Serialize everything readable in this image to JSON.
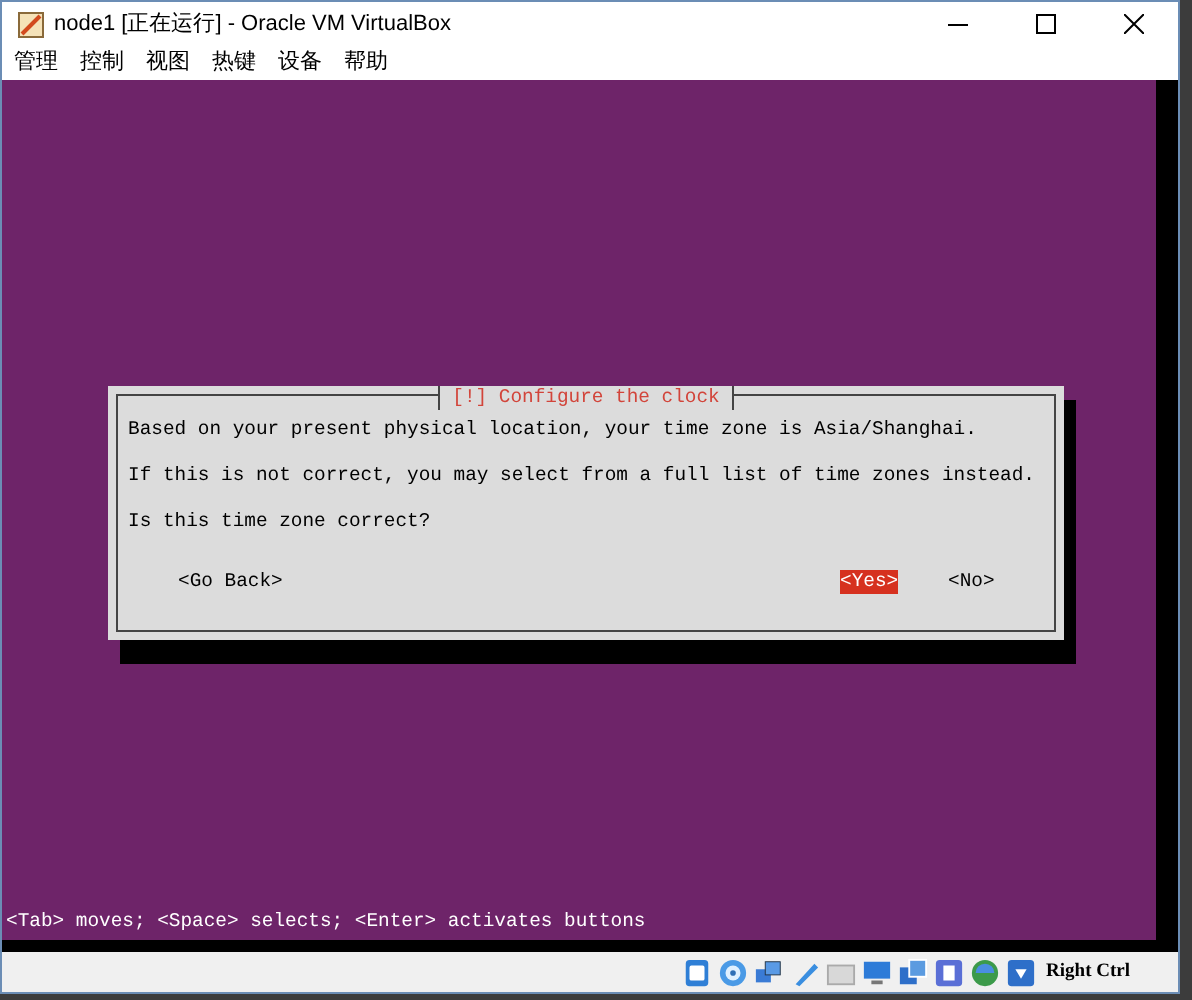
{
  "window": {
    "title": "node1 [正在运行] - Oracle VM VirtualBox"
  },
  "menu": [
    "管理",
    "控制",
    "视图",
    "热键",
    "设备",
    "帮助"
  ],
  "dialog": {
    "title": "[!] Configure the clock",
    "paragraphs": [
      "Based on your present physical location, your time zone is Asia/Shanghai.",
      "If this is not correct, you may select from a full list of time zones instead.",
      "Is this time zone correct?"
    ],
    "buttons": [
      {
        "label": "<Go Back>",
        "selected": false
      },
      {
        "label": "<Yes>",
        "selected": true
      },
      {
        "label": "<No>",
        "selected": false
      }
    ]
  },
  "help_text": "<Tab> moves; <Space> selects; <Enter> activates buttons",
  "status_bar": {
    "host_key": "Right Ctrl"
  }
}
